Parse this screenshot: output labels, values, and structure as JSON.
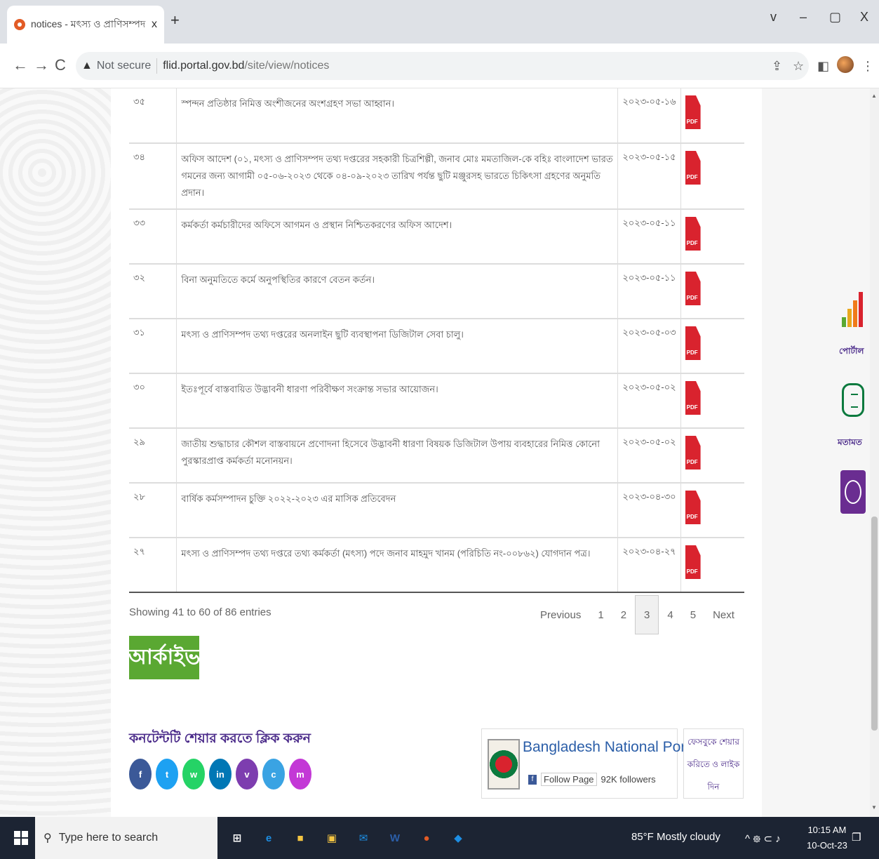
{
  "browser": {
    "tab_title": "notices - মৎস্য ও প্রাণিসম্পদ তথ",
    "tab_close": "x",
    "new_tab": "+",
    "win_chevron": "v",
    "win_minimize": "–",
    "win_restore": "▢",
    "win_close": "X",
    "back": "←",
    "forward": "→",
    "reload": "C",
    "security_icon": "▲",
    "not_secure": "Not secure",
    "url_host": "flid.portal.gov.bd",
    "url_path": "/site/view/notices",
    "share_icon": "⇪",
    "star_icon": "☆",
    "sidebar_icon": "◧",
    "menu_icon": "⋮"
  },
  "notices": [
    {
      "no": "৩৫",
      "title": "স্পন্দন প্রতিষ্ঠার নিমিত্ত অংশীজনের অংশগ্রহণ সভা আহ্বান।",
      "date": "২০২৩-০৫-১৬"
    },
    {
      "no": "৩৪",
      "title": "অফিস আদেশ (০১, মৎস্য ও প্রাণিসম্পদ তথ্য দপ্তরের সহকারী চিত্রশিল্পী, জনাব মোঃ মমতাজিল-কে বহিঃ বাংলাদেশ ভারত গমনের জন্য আগামী ০৫-০৬-২০২৩ থেকে ০৪-০৯-২০২৩ তারিখ পর্যন্ত ছুটি মঞ্জুরসহ ভারতে চিকিৎসা গ্রহণের অনুমতি প্রদান।",
      "date": "২০২৩-০৫-১৫"
    },
    {
      "no": "৩৩",
      "title": "কর্মকর্তা কর্মচারীদের অফিসে আগমন ও প্রস্থান নিশ্চিতকরণের অফিস আদেশ।",
      "date": "২০২৩-০৫-১১"
    },
    {
      "no": "৩২",
      "title": "বিনা অনুমতিতে কর্মে অনুপস্থিতির কারণে বেতন কর্তন।",
      "date": "২০২৩-০৫-১১"
    },
    {
      "no": "৩১",
      "title": "মৎস্য ও প্রাণিসম্পদ তথ্য দপ্তরের অনলাইন ছুটি ব্যবস্থাপনা ডিজিটাল সেবা চালু।",
      "date": "২০২৩-০৫-০৩"
    },
    {
      "no": "৩০",
      "title": "ইতঃপূর্বে বাস্তবায়িত উদ্ভাবনী ধারণা পরিবীক্ষণ সংক্রান্ত সভার আয়োজন।",
      "date": "২০২৩-০৫-০২"
    },
    {
      "no": "২৯",
      "title": "জাতীয় শুদ্ধাচার কৌশল বাস্তবায়নে প্রণোদনা হিসেবে উদ্ভাবনী ধারণা বিষয়ক ডিজিটাল উপায় ব্যবহারের নিমিত্ত কোনো পুরস্কারপ্রাপ্ত কর্মকর্তা মনোনয়ন।",
      "date": "২০২৩-০৫-০২"
    },
    {
      "no": "২৮",
      "title": "বার্ষিক কর্মসম্পাদন চুক্তি ২০২২-২০২৩ এর মাসিক প্রতিবেদন",
      "date": "২০২৩-০৪-৩০"
    },
    {
      "no": "২৭",
      "title": "মৎস্য ও প্রাণিসম্পদ তথ্য দপ্তরে তথ্য কর্মকর্তা (মৎস্য) পদে জনাব মাহমুদ খানম (পরিচিতি নং-০০৮৬২) যোগদান পত্র।",
      "date": "২০২৩-০৪-২৭"
    }
  ],
  "pdf_label": "PDF",
  "pagination": {
    "showing": "Showing 41 to 60 of 86 entries",
    "previous": "Previous",
    "pages": [
      "1",
      "2",
      "3",
      "4",
      "5"
    ],
    "next": "Next"
  },
  "archive_label": "আর্কাইভ",
  "share": {
    "title": "কনটেন্টটি শেয়ার করতে ক্লিক করুন",
    "buttons": [
      {
        "label": "f",
        "color": "#3b5998"
      },
      {
        "label": "t",
        "color": "#1da1f2"
      },
      {
        "label": "w",
        "color": "#25d366"
      },
      {
        "label": "in",
        "color": "#0077b5"
      },
      {
        "label": "v",
        "color": "#7d3daf"
      },
      {
        "label": "c",
        "color": "#3aa3e3"
      },
      {
        "label": "m",
        "color": "#c338d6"
      }
    ]
  },
  "portal": {
    "name": "Bangladesh National Portal",
    "fb_icon": "f",
    "follow": "Follow Page",
    "followers": "92K followers"
  },
  "bn_box": [
    "ফেসবুকে শেয়ার",
    "করিতে ও লাইক",
    "দিন"
  ],
  "side_widgets": {
    "chart_label": "পোর্টাল",
    "chat_label": "মতামত",
    "chart_colors": [
      "#5aa832",
      "#e8a81e",
      "#f07a1a",
      "#d9232e"
    ]
  },
  "taskbar": {
    "search_icon": "⚲",
    "search_placeholder": "Type here to search",
    "apps": [
      {
        "label": "⊞",
        "color": "#ffffff"
      },
      {
        "label": "e",
        "color": "#1d8ee3"
      },
      {
        "label": "■",
        "color": "#f4c542"
      },
      {
        "label": "▣",
        "color": "#f4c542"
      },
      {
        "label": "✉",
        "color": "#1d8ee3"
      },
      {
        "label": "W",
        "color": "#2b5ea8"
      },
      {
        "label": "●",
        "color": "#e25b26"
      },
      {
        "label": "◆",
        "color": "#1d8ee3"
      }
    ],
    "weather": "85°F Mostly cloudy",
    "tray_icons": "^ ᪥ ⊂ ♪",
    "time": "10:15 AM",
    "date": "10-Oct-23",
    "notify_icon": "❐"
  }
}
